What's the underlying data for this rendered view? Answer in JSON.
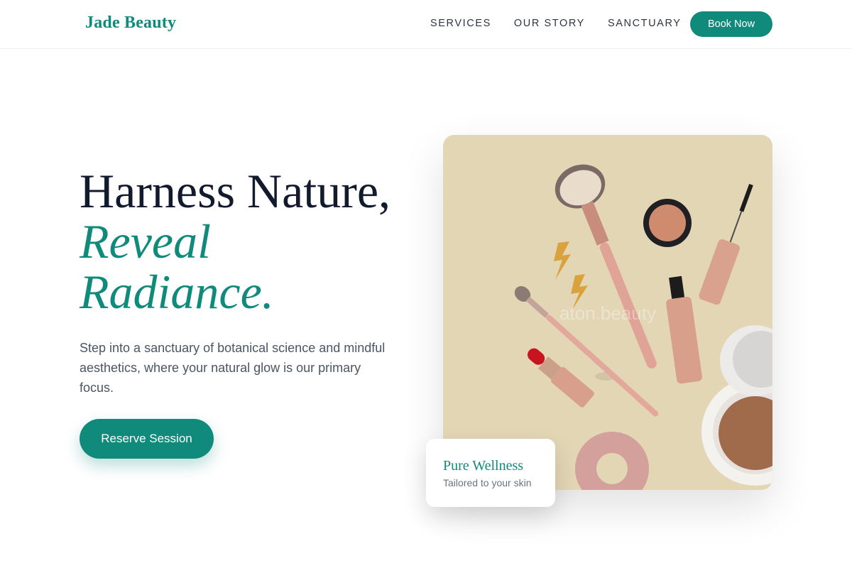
{
  "brand": {
    "name": "Jade Beauty",
    "accent_color": "#0f8a7b"
  },
  "nav": {
    "items": [
      {
        "label": "SERVICES"
      },
      {
        "label": "OUR STORY"
      },
      {
        "label": "SANCTUARY"
      }
    ],
    "cta_label": "Book Now"
  },
  "hero": {
    "title_line1": "Harness Nature,",
    "title_line2": "Reveal",
    "title_line3": "Radiance.",
    "description": "Step into a sanctuary of botanical science and mindful aesthetics, where your natural glow is our primary focus.",
    "cta_label": "Reserve Session",
    "image_background_color": "#e3d6b5",
    "image_watermark": "aton.beauty"
  },
  "feature_card": {
    "title": "Pure Wellness",
    "subtitle": "Tailored to your skin"
  }
}
